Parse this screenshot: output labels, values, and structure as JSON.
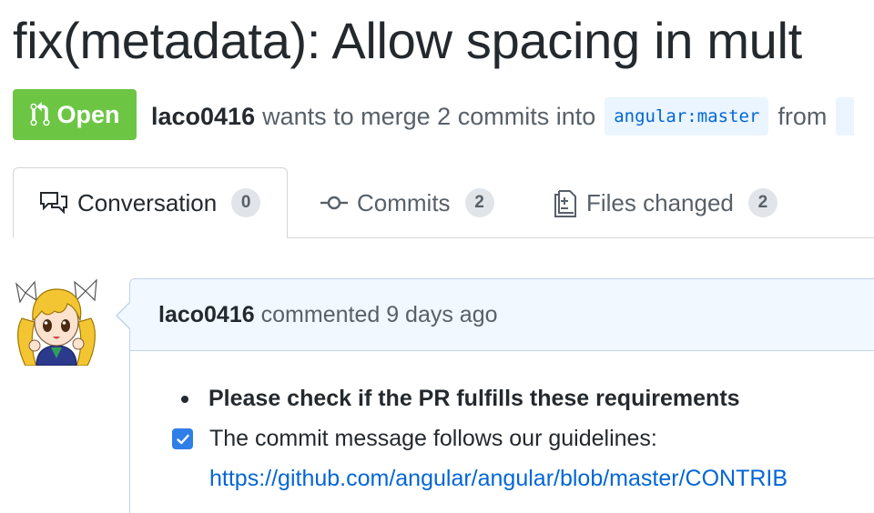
{
  "pull_request": {
    "title": "fix(metadata): Allow spacing in mult",
    "state": "Open",
    "author": "laco0416",
    "merge_text": "wants to merge 2 commits into",
    "base_branch": "angular:master",
    "from_text": "from"
  },
  "tabs": [
    {
      "label": "Conversation",
      "count": "0",
      "icon": "comment-discussion-icon",
      "selected": true
    },
    {
      "label": "Commits",
      "count": "2",
      "icon": "git-commit-icon",
      "selected": false
    },
    {
      "label": "Files changed",
      "count": "2",
      "icon": "file-diff-icon",
      "selected": false
    }
  ],
  "comment": {
    "author": "laco0416",
    "action": "commented 9 days ago",
    "avatar_icon": "anime-character-avatar",
    "bullet_heading": "Please check if the PR fulfills these requirements",
    "task": {
      "checked": true,
      "text": "The commit message follows our guidelines:",
      "link": "https://github.com/angular/angular/blob/master/CONTRIB"
    }
  },
  "colors": {
    "open_badge": "#6cc644",
    "link": "#0366d6",
    "branch_bg": "#eaf5ff",
    "comment_header_bg": "#f1f8ff",
    "checkbox": "#2f7fe8"
  }
}
